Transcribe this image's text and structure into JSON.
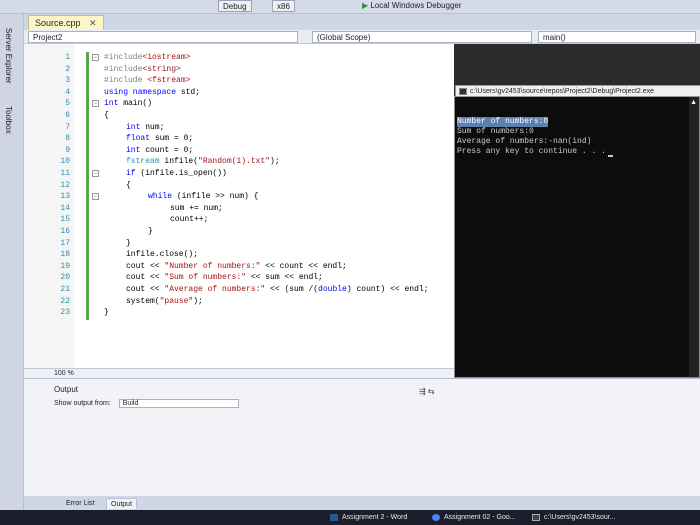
{
  "toolbar": {
    "config": "Debug",
    "platform": "x86",
    "debugger": "Local Windows Debugger"
  },
  "side_tabs": [
    "Server Explorer",
    "Toolbox"
  ],
  "editor": {
    "tab_label": "Source.cpp",
    "project": "Project2",
    "scope": "(Global Scope)",
    "function": "main()",
    "zoom": "100 %",
    "lines": [
      {
        "n": "1",
        "fold": "⊟",
        "indent": 0,
        "parts": [
          {
            "t": "#include",
            "c": "pp"
          },
          {
            "t": "<iostream>",
            "c": "str"
          }
        ]
      },
      {
        "n": "2",
        "fold": "",
        "indent": 0,
        "parts": [
          {
            "t": "#include",
            "c": "pp"
          },
          {
            "t": "<string>",
            "c": "str"
          }
        ]
      },
      {
        "n": "3",
        "fold": "",
        "indent": 0,
        "parts": [
          {
            "t": "#include ",
            "c": "pp"
          },
          {
            "t": "<fstream>",
            "c": "str"
          }
        ]
      },
      {
        "n": "4",
        "fold": "",
        "indent": 0,
        "parts": [
          {
            "t": "using namespace ",
            "c": "kw"
          },
          {
            "t": "std;",
            "c": ""
          }
        ]
      },
      {
        "n": "5",
        "fold": "⊟",
        "indent": 0,
        "parts": [
          {
            "t": "int ",
            "c": "kw"
          },
          {
            "t": "main()",
            "c": ""
          }
        ]
      },
      {
        "n": "6",
        "fold": "",
        "indent": 0,
        "parts": [
          {
            "t": "{",
            "c": ""
          }
        ]
      },
      {
        "n": "7",
        "fold": "",
        "indent": 1,
        "parts": [
          {
            "t": "int ",
            "c": "kw"
          },
          {
            "t": "num;",
            "c": ""
          }
        ]
      },
      {
        "n": "8",
        "fold": "",
        "indent": 1,
        "parts": [
          {
            "t": "float ",
            "c": "kw"
          },
          {
            "t": "sum = 0;",
            "c": ""
          }
        ]
      },
      {
        "n": "9",
        "fold": "",
        "indent": 1,
        "parts": [
          {
            "t": "int ",
            "c": "kw"
          },
          {
            "t": "count = 0;",
            "c": ""
          }
        ]
      },
      {
        "n": "10",
        "fold": "",
        "indent": 1,
        "parts": [
          {
            "t": "fstream ",
            "c": "ty"
          },
          {
            "t": "infile(",
            "c": ""
          },
          {
            "t": "\"Random(1).txt\"",
            "c": "str"
          },
          {
            "t": ");",
            "c": ""
          }
        ]
      },
      {
        "n": "11",
        "fold": "⊟",
        "indent": 1,
        "parts": [
          {
            "t": "if ",
            "c": "kw"
          },
          {
            "t": "(infile.is_open())",
            "c": ""
          }
        ]
      },
      {
        "n": "12",
        "fold": "",
        "indent": 1,
        "parts": [
          {
            "t": "{",
            "c": ""
          }
        ]
      },
      {
        "n": "13",
        "fold": "⊟",
        "indent": 2,
        "parts": [
          {
            "t": "while ",
            "c": "kw"
          },
          {
            "t": "(infile >> num) {",
            "c": ""
          }
        ]
      },
      {
        "n": "14",
        "fold": "",
        "indent": 3,
        "parts": [
          {
            "t": "sum += num;",
            "c": ""
          }
        ]
      },
      {
        "n": "15",
        "fold": "",
        "indent": 3,
        "parts": [
          {
            "t": "count++;",
            "c": ""
          }
        ]
      },
      {
        "n": "16",
        "fold": "",
        "indent": 2,
        "parts": [
          {
            "t": "}",
            "c": ""
          }
        ]
      },
      {
        "n": "17",
        "fold": "",
        "indent": 1,
        "parts": [
          {
            "t": "}",
            "c": ""
          }
        ]
      },
      {
        "n": "18",
        "fold": "",
        "indent": 1,
        "parts": [
          {
            "t": "infile.close();",
            "c": ""
          }
        ]
      },
      {
        "n": "19",
        "fold": "",
        "indent": 1,
        "parts": [
          {
            "t": "cout << ",
            "c": ""
          },
          {
            "t": "\"Number of numbers:\"",
            "c": "str"
          },
          {
            "t": " << count << endl;",
            "c": ""
          }
        ]
      },
      {
        "n": "20",
        "fold": "",
        "indent": 1,
        "parts": [
          {
            "t": "cout << ",
            "c": ""
          },
          {
            "t": "\"Sum of numbers:\"",
            "c": "str"
          },
          {
            "t": " << sum << endl;",
            "c": ""
          }
        ]
      },
      {
        "n": "21",
        "fold": "",
        "indent": 1,
        "parts": [
          {
            "t": "cout << ",
            "c": ""
          },
          {
            "t": "\"Average of numbers:\"",
            "c": "str"
          },
          {
            "t": " << (sum /(",
            "c": ""
          },
          {
            "t": "double",
            "c": "kw"
          },
          {
            "t": ") count) << endl;",
            "c": ""
          }
        ]
      },
      {
        "n": "22",
        "fold": "",
        "indent": 1,
        "parts": [
          {
            "t": "system(",
            "c": ""
          },
          {
            "t": "\"pause\"",
            "c": "str"
          },
          {
            "t": ");",
            "c": ""
          }
        ]
      },
      {
        "n": "23",
        "fold": "",
        "indent": 0,
        "parts": [
          {
            "t": "}",
            "c": ""
          }
        ]
      }
    ]
  },
  "console": {
    "title": "c:\\Users\\gv2453\\source\\repos\\Project2\\Debug\\Project2.exe",
    "lines": [
      "Number of numbers:0",
      "Sum of numbers:0",
      "Average of numbers:-nan(ind)",
      "Press any key to continue . . ."
    ]
  },
  "output": {
    "title": "Output",
    "show_from_label": "Show output from:",
    "source": "Build"
  },
  "bottom_tabs": [
    "Error List",
    "Output"
  ],
  "taskbar": [
    {
      "label": "Assignment 2 - Word",
      "color": "#2b579a"
    },
    {
      "label": "Assignment 02 - Goo...",
      "color": "#4285f4"
    },
    {
      "label": "c:\\Users\\gv2453\\sour...",
      "color": "#444444"
    }
  ]
}
